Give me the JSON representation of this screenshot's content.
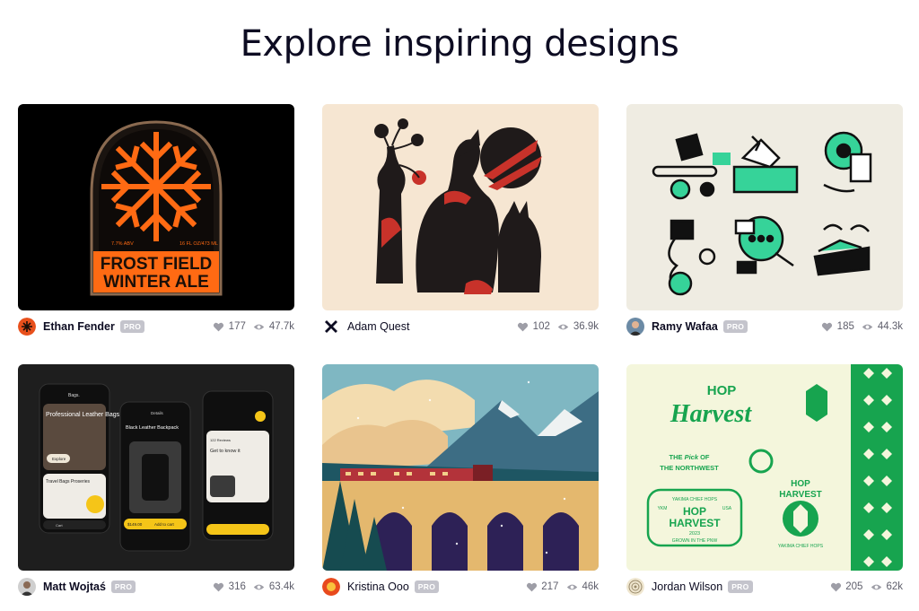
{
  "header": {
    "title": "Explore inspiring designs"
  },
  "colors": {
    "accent": "#ea4c89",
    "pro_badge": "#c4c4cc",
    "stat_text": "#5e5e6b"
  },
  "shots": [
    {
      "author": "Ethan Fender",
      "pro": "PRO",
      "likes": "177",
      "views": "47.7k",
      "artwork_text": {
        "abv": "7.7% ABV",
        "volume": "16 FL OZ/473 ML",
        "line1": "FROST FIELD",
        "line2": "WINTER ALE"
      }
    },
    {
      "author": "Adam Quest",
      "pro": "",
      "likes": "102",
      "views": "36.9k"
    },
    {
      "author": "Ramy Wafaa",
      "pro": "PRO",
      "likes": "185",
      "views": "44.3k"
    },
    {
      "author": "Matt Wojtaś",
      "pro": "PRO",
      "likes": "316",
      "views": "63.4k",
      "artwork_text": {
        "brand": "Bags.",
        "headline": "Professional Leather Bags",
        "explore": "Explore",
        "section": "Travel Bags Proseries",
        "cart": "Cart",
        "detail_title": "Details",
        "product": "Black Leather Backpack",
        "price": "$149.00",
        "add": "Add to cart",
        "get_to_know": "Get to know it",
        "reviews": "122 Reviews"
      }
    },
    {
      "author": "Kristina Ooo",
      "pro": "PRO",
      "likes": "217",
      "views": "46k"
    },
    {
      "author": "Jordan Wilson",
      "pro": "PRO",
      "likes": "205",
      "views": "62k",
      "artwork_text": {
        "hop": "HOP",
        "harvest": "Harvest",
        "pick1": "THE ",
        "pick2": "Pick",
        "pick3": " OF",
        "northwest": "THE NORTHWEST",
        "badge_top": "YAKIMA CHIEF HOPS",
        "badge_hop": "HOP",
        "badge_harvest": "HARVEST",
        "badge_year": "2023",
        "badge_bottom": "GROWN IN THE PNW",
        "ykm": "YKM",
        "usa": "USA",
        "hop2": "HOP",
        "harvest2": "HARVEST",
        "yakima": "YAKIMA CHIEF HOPS"
      }
    }
  ]
}
